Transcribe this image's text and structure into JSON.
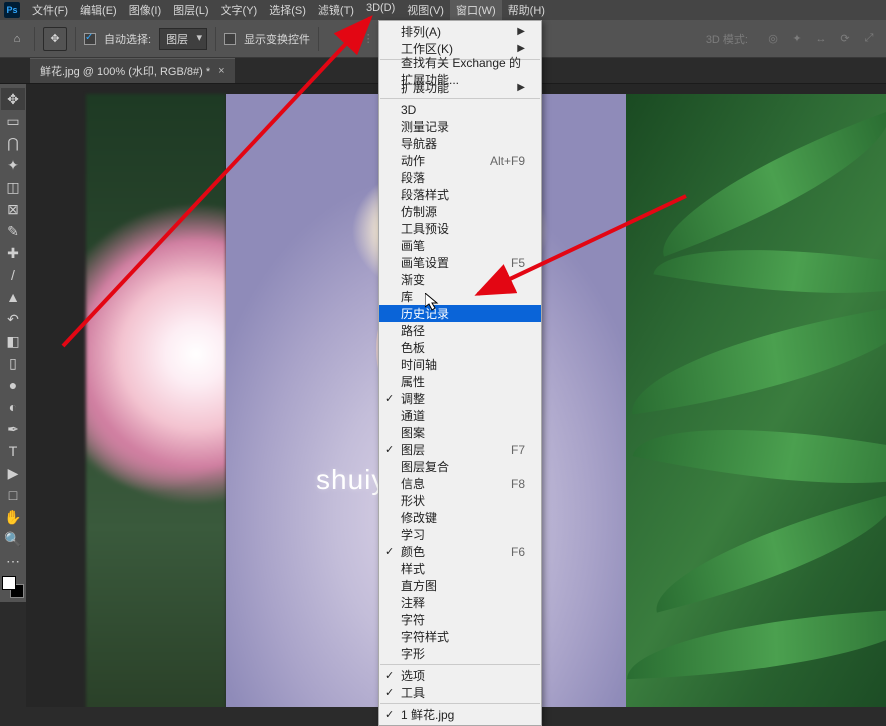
{
  "menubar": {
    "items": [
      "文件(F)",
      "编辑(E)",
      "图像(I)",
      "图层(L)",
      "文字(Y)",
      "选择(S)",
      "滤镜(T)",
      "3D(D)",
      "视图(V)",
      "窗口(W)",
      "帮助(H)"
    ],
    "active_index": 9
  },
  "optionsbar": {
    "auto_select_label": "自动选择:",
    "mode_value": "图层",
    "show_transform_label": "显示变换控件",
    "align_group_label": "",
    "mode3d_label": "3D 模式:"
  },
  "tab": {
    "title": "鲜花.jpg @ 100% (水印, RGB/8#) *"
  },
  "watermark_text": "shuiyin",
  "tools": [
    {
      "name": "move",
      "glyph": "✥",
      "sel": true
    },
    {
      "name": "marquee",
      "glyph": "▭"
    },
    {
      "name": "lasso",
      "glyph": "⋂"
    },
    {
      "name": "quick-select",
      "glyph": "✦"
    },
    {
      "name": "crop",
      "glyph": "◫"
    },
    {
      "name": "frame",
      "glyph": "⊠"
    },
    {
      "name": "eyedropper",
      "glyph": "✎"
    },
    {
      "name": "healing",
      "glyph": "✚"
    },
    {
      "name": "brush",
      "glyph": "/"
    },
    {
      "name": "stamp",
      "glyph": "▲"
    },
    {
      "name": "history-brush",
      "glyph": "↶"
    },
    {
      "name": "eraser",
      "glyph": "◧"
    },
    {
      "name": "gradient",
      "glyph": "▯"
    },
    {
      "name": "blur",
      "glyph": "●"
    },
    {
      "name": "dodge",
      "glyph": "◐"
    },
    {
      "name": "pen",
      "glyph": "✒"
    },
    {
      "name": "type",
      "glyph": "T"
    },
    {
      "name": "path-select",
      "glyph": "▶"
    },
    {
      "name": "rectangle",
      "glyph": "□"
    },
    {
      "name": "hand",
      "glyph": "✋"
    },
    {
      "name": "zoom",
      "glyph": "🔍"
    },
    {
      "name": "more",
      "glyph": "⋯"
    }
  ],
  "dropdown": {
    "groups": [
      [
        {
          "label": "排列(A)",
          "checked": false,
          "shortcut": "",
          "sub": true
        },
        {
          "label": "工作区(K)",
          "checked": false,
          "shortcut": "",
          "sub": true
        }
      ],
      [
        {
          "label": "查找有关 Exchange 的扩展功能...",
          "checked": false,
          "shortcut": ""
        },
        {
          "label": "扩展功能",
          "checked": false,
          "shortcut": "",
          "sub": true
        }
      ],
      [
        {
          "label": "3D",
          "checked": false,
          "shortcut": ""
        },
        {
          "label": "测量记录",
          "checked": false,
          "shortcut": ""
        },
        {
          "label": "导航器",
          "checked": false,
          "shortcut": ""
        },
        {
          "label": "动作",
          "checked": false,
          "shortcut": "Alt+F9"
        },
        {
          "label": "段落",
          "checked": false,
          "shortcut": ""
        },
        {
          "label": "段落样式",
          "checked": false,
          "shortcut": ""
        },
        {
          "label": "仿制源",
          "checked": false,
          "shortcut": ""
        },
        {
          "label": "工具预设",
          "checked": false,
          "shortcut": ""
        },
        {
          "label": "画笔",
          "checked": false,
          "shortcut": ""
        },
        {
          "label": "画笔设置",
          "checked": false,
          "shortcut": "F5"
        },
        {
          "label": "渐变",
          "checked": false,
          "shortcut": ""
        },
        {
          "label": "库",
          "checked": false,
          "shortcut": ""
        },
        {
          "label": "历史记录",
          "checked": false,
          "shortcut": "",
          "highlighted": true
        },
        {
          "label": "路径",
          "checked": false,
          "shortcut": ""
        },
        {
          "label": "色板",
          "checked": false,
          "shortcut": ""
        },
        {
          "label": "时间轴",
          "checked": false,
          "shortcut": ""
        },
        {
          "label": "属性",
          "checked": false,
          "shortcut": ""
        },
        {
          "label": "调整",
          "checked": true,
          "shortcut": ""
        },
        {
          "label": "通道",
          "checked": false,
          "shortcut": ""
        },
        {
          "label": "图案",
          "checked": false,
          "shortcut": ""
        },
        {
          "label": "图层",
          "checked": true,
          "shortcut": "F7"
        },
        {
          "label": "图层复合",
          "checked": false,
          "shortcut": ""
        },
        {
          "label": "信息",
          "checked": false,
          "shortcut": "F8"
        },
        {
          "label": "形状",
          "checked": false,
          "shortcut": ""
        },
        {
          "label": "修改键",
          "checked": false,
          "shortcut": ""
        },
        {
          "label": "学习",
          "checked": false,
          "shortcut": ""
        },
        {
          "label": "颜色",
          "checked": true,
          "shortcut": "F6"
        },
        {
          "label": "样式",
          "checked": false,
          "shortcut": ""
        },
        {
          "label": "直方图",
          "checked": false,
          "shortcut": ""
        },
        {
          "label": "注释",
          "checked": false,
          "shortcut": ""
        },
        {
          "label": "字符",
          "checked": false,
          "shortcut": ""
        },
        {
          "label": "字符样式",
          "checked": false,
          "shortcut": ""
        },
        {
          "label": "字形",
          "checked": false,
          "shortcut": ""
        }
      ],
      [
        {
          "label": "选项",
          "checked": true,
          "shortcut": ""
        },
        {
          "label": "工具",
          "checked": true,
          "shortcut": ""
        }
      ],
      [
        {
          "label": "1 鲜花.jpg",
          "checked": true,
          "shortcut": ""
        }
      ]
    ]
  }
}
